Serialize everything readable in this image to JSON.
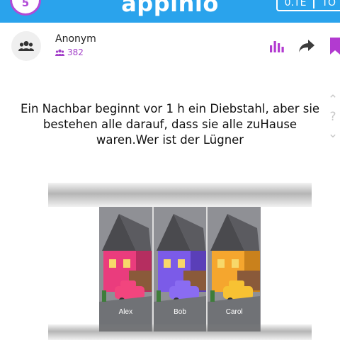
{
  "header": {
    "progress_value": "5",
    "logo_text": "appinio",
    "score_left": "0.TE",
    "score_right": "TO"
  },
  "author": {
    "name": "Anonym",
    "followers": "382"
  },
  "question": {
    "text": "Ein Nachbar beginnt vor 1 h ein Diebstahl, aber sie bestehen alle darauf, dass sie alle zuHause waren.Wer ist der Lügner"
  },
  "side_nav": {
    "up": "⌃",
    "help": "?",
    "down": "⌄"
  },
  "image": {
    "panels": [
      {
        "name": "Alex",
        "house_color": "#ea3c7d",
        "car_color": "#f2457e"
      },
      {
        "name": "Bob",
        "house_color": "#7b5be8",
        "car_color": "#8a6cf2"
      },
      {
        "name": "Carol",
        "house_color": "#f5a62e",
        "car_color": "#f7c233"
      }
    ]
  },
  "colors": {
    "brand_blue": "#2aa3ec",
    "accent_purple": "#a23fc8"
  },
  "icons": [
    "avatar-group-icon",
    "followers-icon",
    "bar-chart-icon",
    "share-arrow-icon",
    "bookmark-icon"
  ]
}
